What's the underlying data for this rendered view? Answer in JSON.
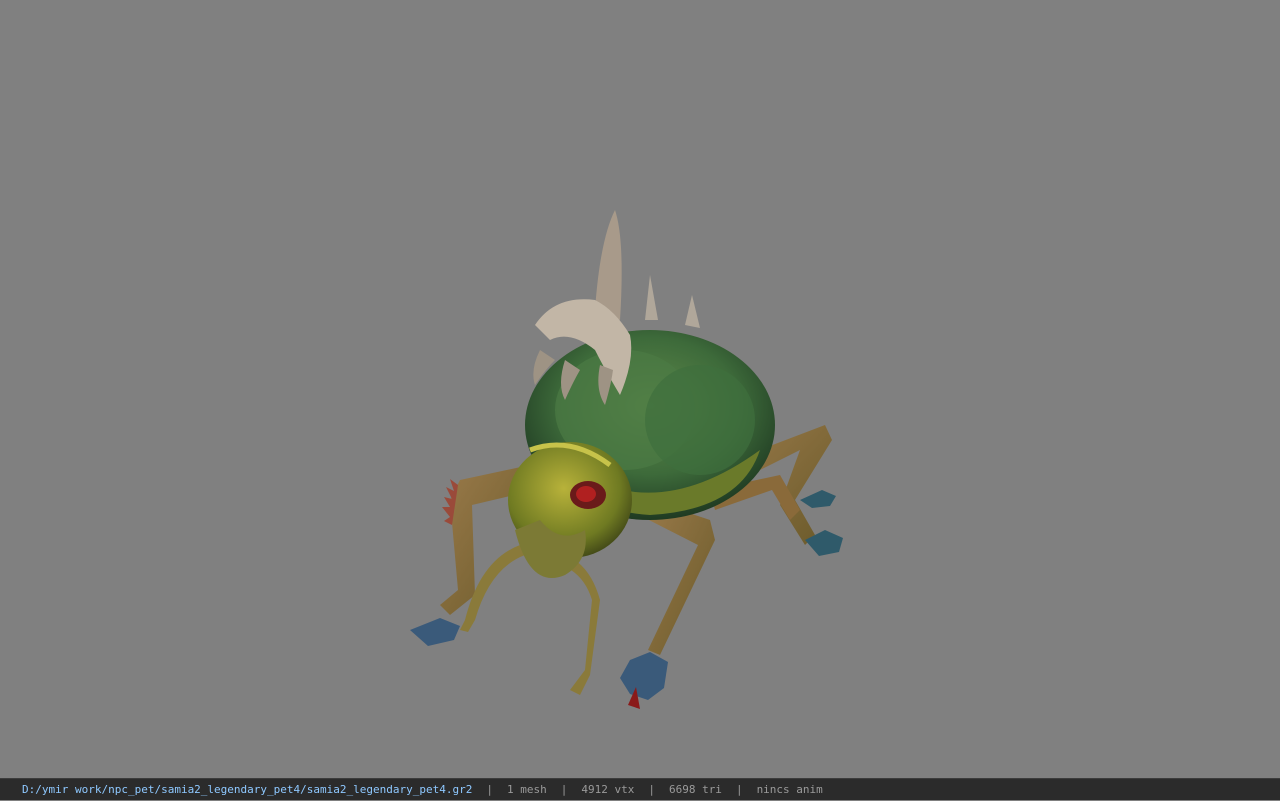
{
  "viewer": {
    "background_color": "#808080",
    "model_name": "samia2_legendary_pet4",
    "model_icon": "beetle-creature-model"
  },
  "statusbar": {
    "file_path": "D:/ymir work/npc_pet/samia2_legendary_pet4/samia2_legendary_pet4.gr2",
    "separator": "|",
    "mesh": "1 mesh",
    "vertices": "4912 vtx",
    "triangles": "6698 tri",
    "animation": "nincs anim",
    "path_color": "#8ec8ff",
    "text_color": "#9a9a9a"
  }
}
